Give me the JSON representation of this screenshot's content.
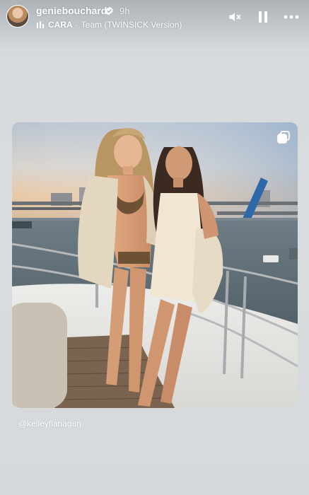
{
  "story": {
    "username": "geniebouchard",
    "verified": true,
    "time": "9h",
    "music": {
      "icon": "music-bars-icon",
      "artist": "CARA",
      "separator": "·",
      "title": "Team (TWINSICK Version)"
    },
    "controls": [
      {
        "name": "mute-icon"
      },
      {
        "name": "pause-icon"
      },
      {
        "name": "more-options-icon"
      }
    ]
  },
  "post": {
    "multi_image_icon": "carousel-icon",
    "mention": "@kelleyflanagan"
  },
  "colors": {
    "background": "#d7dbde",
    "text": "#ffffff"
  }
}
